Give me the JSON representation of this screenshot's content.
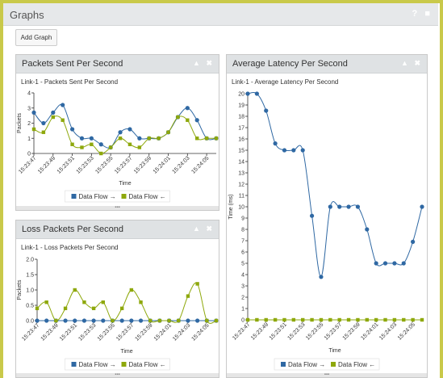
{
  "page": {
    "title": "Graphs",
    "help_icon": "?",
    "video_icon": "■",
    "add_graph_label": "Add Graph"
  },
  "panels": [
    {
      "title": "Packets Sent Per Second",
      "collapse_icon": "▲",
      "close_icon": "✖"
    },
    {
      "title": "Loss Packets Per Second",
      "collapse_icon": "▲",
      "close_icon": "✖"
    },
    {
      "title": "Average Latency Per Second",
      "collapse_icon": "▲",
      "close_icon": "✖"
    }
  ],
  "colors": {
    "series_forward": "#2f68a3",
    "series_back": "#8ea80c"
  },
  "chart_data": [
    {
      "type": "line",
      "title": "Link-1 - Packets Sent Per Second",
      "xlabel": "Time",
      "ylabel": "Packets",
      "ylim": [
        0,
        4
      ],
      "yticks": [
        "0",
        "1",
        "2",
        "3",
        "4"
      ],
      "xticks": [
        "15:23:47",
        "15:23:49",
        "15:23:51",
        "15:23:53",
        "15:23:55",
        "15:23:57",
        "15:23:59",
        "15:24:01",
        "15:24:03",
        "15:24:05"
      ],
      "x": [
        0,
        1,
        2,
        3,
        4,
        5,
        6,
        7,
        8,
        9,
        10,
        11,
        12,
        13,
        14,
        15,
        16,
        17,
        18,
        19
      ],
      "series": [
        {
          "name": "Data Flow →",
          "values": [
            2.7,
            2.0,
            2.7,
            3.2,
            1.6,
            1.0,
            1.0,
            0.6,
            0.4,
            1.4,
            1.6,
            1.0,
            1.0,
            1.0,
            1.4,
            2.4,
            3.0,
            2.2,
            1.0,
            1.0
          ]
        },
        {
          "name": "Data Flow ←",
          "values": [
            1.6,
            1.4,
            2.4,
            2.2,
            0.6,
            0.4,
            0.6,
            0.0,
            0.4,
            1.0,
            0.6,
            0.4,
            1.0,
            1.0,
            1.4,
            2.4,
            2.2,
            1.0,
            1.0,
            1.0
          ]
        }
      ]
    },
    {
      "type": "line",
      "title": "Link-1 - Loss Packets Per Second",
      "xlabel": "Time",
      "ylabel": "Packets",
      "ylim": [
        0,
        2
      ],
      "yticks": [
        "0.0",
        "0.5",
        "1.0",
        "1.5",
        "2.0"
      ],
      "xticks": [
        "15:23:47",
        "15:23:49",
        "15:23:51",
        "15:23:53",
        "15:23:55",
        "15:23:57",
        "15:23:59",
        "15:24:01",
        "15:24:03",
        "15:24:05"
      ],
      "x": [
        0,
        1,
        2,
        3,
        4,
        5,
        6,
        7,
        8,
        9,
        10,
        11,
        12,
        13,
        14,
        15,
        16,
        17,
        18,
        19
      ],
      "series": [
        {
          "name": "Data Flow →",
          "values": [
            0,
            0,
            0,
            0,
            0,
            0,
            0,
            0,
            0,
            0,
            0,
            0,
            0,
            0,
            0,
            0,
            0,
            0,
            0,
            0
          ]
        },
        {
          "name": "Data Flow ←",
          "values": [
            0.4,
            0.6,
            0,
            0.4,
            1.0,
            0.6,
            0.4,
            0.6,
            0,
            0.4,
            1.0,
            0.6,
            0,
            0,
            0,
            0,
            0.8,
            1.2,
            0,
            0
          ]
        }
      ]
    },
    {
      "type": "line",
      "title": "Link-1 - Average Latency Per Second",
      "xlabel": "Time",
      "ylabel": "Time (ms)",
      "ylim": [
        0,
        20
      ],
      "yticks": [
        "0",
        "1",
        "2",
        "3",
        "4",
        "5",
        "6",
        "7",
        "8",
        "9",
        "10",
        "11",
        "12",
        "13",
        "14",
        "15",
        "16",
        "17",
        "18",
        "19",
        "20"
      ],
      "xticks": [
        "15:23:47",
        "15:23:49",
        "15:23:51",
        "15:23:53",
        "15:23:55",
        "15:23:57",
        "15:23:59",
        "15:24:01",
        "15:24:03",
        "15:24:05"
      ],
      "x": [
        0,
        1,
        2,
        3,
        4,
        5,
        6,
        7,
        8,
        9,
        10,
        11,
        12,
        13,
        14,
        15,
        16,
        17,
        18,
        19
      ],
      "series": [
        {
          "name": "Data Flow →",
          "values": [
            20,
            20,
            18.5,
            15.6,
            15.0,
            15.0,
            15.0,
            9.2,
            3.8,
            10.0,
            10.0,
            10.0,
            10.0,
            8.0,
            5.0,
            5.0,
            5.0,
            5.0,
            6.9,
            10.0
          ]
        },
        {
          "name": "Data Flow ←",
          "values": [
            0,
            0,
            0,
            0,
            0,
            0,
            0,
            0,
            0,
            0,
            0,
            0,
            0,
            0,
            0,
            0,
            0,
            0,
            0,
            0
          ]
        }
      ]
    }
  ]
}
